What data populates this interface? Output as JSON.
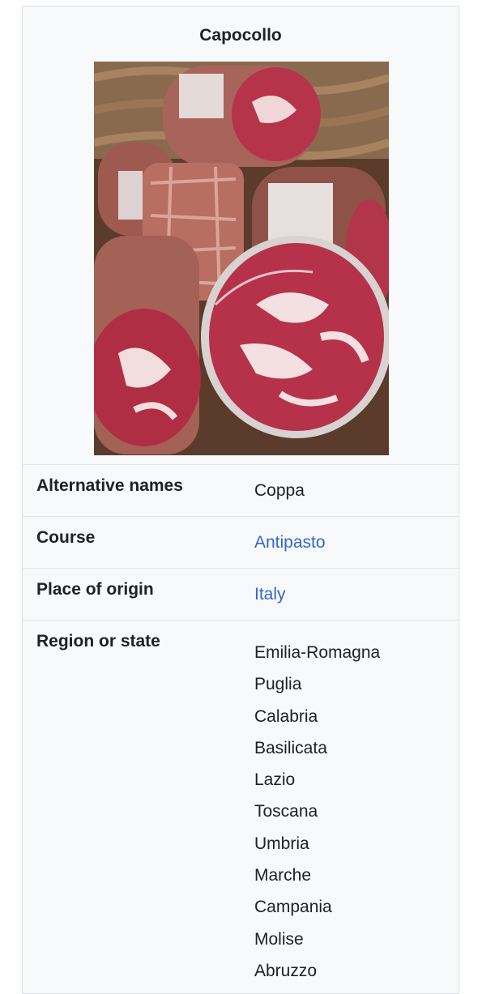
{
  "infobox": {
    "title": "Capocollo",
    "rows": [
      {
        "label": "Alternative names",
        "value": "Coppa"
      },
      {
        "label": "Course",
        "value": "Antipasto"
      },
      {
        "label": "Place of origin",
        "value": "Italy"
      }
    ],
    "region": {
      "label": "Region or state",
      "values": [
        "Emilia-Romagna",
        "Puglia",
        "Calabria",
        "Basilicata",
        "Lazio",
        "Toscana",
        "Umbria",
        "Marche",
        "Campania",
        "Molise",
        "Abruzzo"
      ]
    }
  },
  "colors": {
    "link": "#3366cc",
    "text": "#202122",
    "background": "#f8f9fa"
  }
}
